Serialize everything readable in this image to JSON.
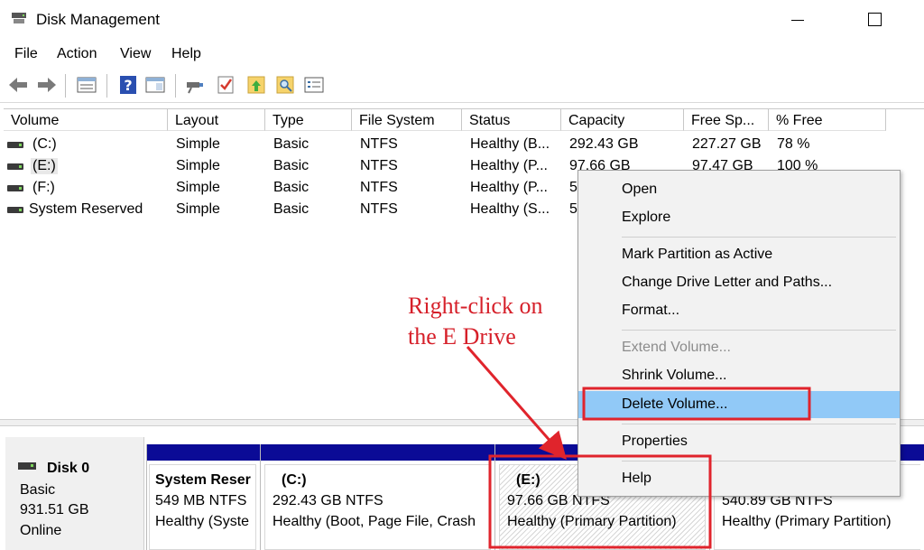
{
  "window": {
    "title": "Disk Management"
  },
  "menu": [
    "File",
    "Action",
    "View",
    "Help"
  ],
  "toolbar_icons": [
    "back-arrow-icon",
    "forward-arrow-icon",
    "list-view-icon",
    "help-icon",
    "properties-panel-icon",
    "connect-icon",
    "checklist-icon",
    "folder-up-icon",
    "folder-search-icon",
    "settings-list-icon"
  ],
  "columns": [
    "Volume",
    "Layout",
    "Type",
    "File System",
    "Status",
    "Capacity",
    "Free Sp...",
    "% Free"
  ],
  "volumes": [
    {
      "name": "(C:)",
      "layout": "Simple",
      "type": "Basic",
      "fs": "NTFS",
      "status": "Healthy (B...",
      "capacity": "292.43 GB",
      "free": "227.27 GB",
      "pct": "78 %"
    },
    {
      "name": "(E:)",
      "layout": "Simple",
      "type": "Basic",
      "fs": "NTFS",
      "status": "Healthy (P...",
      "capacity": "97.66 GB",
      "free": "97.47 GB",
      "pct": "100 %"
    },
    {
      "name": "(F:)",
      "layout": "Simple",
      "type": "Basic",
      "fs": "NTFS",
      "status": "Healthy (P...",
      "capacity": "5",
      "free": "",
      "pct": ""
    },
    {
      "name": "System Reserved",
      "layout": "Simple",
      "type": "Basic",
      "fs": "NTFS",
      "status": "Healthy (S...",
      "capacity": "5",
      "free": "",
      "pct": ""
    }
  ],
  "disk": {
    "name": "Disk 0",
    "kind": "Basic",
    "size": "931.51 GB",
    "state": "Online"
  },
  "partitions": [
    {
      "title": "System Reser",
      "size": "549 MB NTFS",
      "status": "Healthy (Syste"
    },
    {
      "title": "(C:)",
      "size": "292.43 GB NTFS",
      "status": "Healthy (Boot, Page File, Crash"
    },
    {
      "title": "(E:)",
      "size": "97.66 GB NTFS",
      "status": "Healthy (Primary Partition)"
    },
    {
      "title": "",
      "size": "540.89 GB NTFS",
      "status": "Healthy (Primary Partition)"
    }
  ],
  "context_menu": {
    "open": "Open",
    "explore": "Explore",
    "mark_active": "Mark Partition as Active",
    "change_letter": "Change Drive Letter and Paths...",
    "format": "Format...",
    "extend": "Extend Volume...",
    "shrink": "Shrink Volume...",
    "delete": "Delete Volume...",
    "properties": "Properties",
    "help": "Help"
  },
  "annotation": {
    "line1": "Right-click on",
    "line2": "the E Drive",
    "color": "#d6202a"
  },
  "colors": {
    "partition_bar": "#0b0b96",
    "menu_highlight": "#91c9f7"
  }
}
